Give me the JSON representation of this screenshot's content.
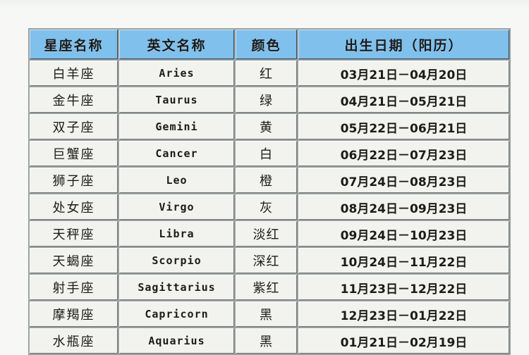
{
  "page": {
    "background_color": "#f7f8f6",
    "top_strip_ghost_text": "· · · · ·    · ·    · · · ·"
  },
  "table": {
    "name": "zodiac-sign-reference-table",
    "header_fill": "#7fc0ec",
    "cell_fill": "#f2f2ee",
    "border_color": "#6f7573",
    "columns": [
      {
        "key": "name_cn",
        "label": "星座名称"
      },
      {
        "key": "name_en",
        "label": "英文名称"
      },
      {
        "key": "color",
        "label": "颜色"
      },
      {
        "key": "dates",
        "label": "出生日期（阳历）"
      }
    ],
    "rows": [
      {
        "name_cn": "白羊座",
        "name_en": "Aries",
        "color": "红",
        "dates": "03月21日－04月20日"
      },
      {
        "name_cn": "金牛座",
        "name_en": "Taurus",
        "color": "绿",
        "dates": "04月21日－05月21日"
      },
      {
        "name_cn": "双子座",
        "name_en": "Gemini",
        "color": "黄",
        "dates": "05月22日－06月21日"
      },
      {
        "name_cn": "巨蟹座",
        "name_en": "Cancer",
        "color": "白",
        "dates": "06月22日－07月23日"
      },
      {
        "name_cn": "狮子座",
        "name_en": "Leo",
        "color": "橙",
        "dates": "07月24日－08月23日"
      },
      {
        "name_cn": "处女座",
        "name_en": "Virgo",
        "color": "灰",
        "dates": "08月24日－09月23日"
      },
      {
        "name_cn": "天秤座",
        "name_en": "Libra",
        "color": "淡红",
        "dates": "09月24日－10月23日"
      },
      {
        "name_cn": "天蝎座",
        "name_en": "Scorpio",
        "color": "深红",
        "dates": "10月24日－11月22日"
      },
      {
        "name_cn": "射手座",
        "name_en": "Sagittarius",
        "color": "紫红",
        "dates": "11月23日－12月22日"
      },
      {
        "name_cn": "摩羯座",
        "name_en": "Capricorn",
        "color": "黑",
        "dates": "12月23日－01月22日"
      },
      {
        "name_cn": "水瓶座",
        "name_en": "Aquarius",
        "color": "黑",
        "dates": "01月21日－02月19日"
      }
    ]
  }
}
